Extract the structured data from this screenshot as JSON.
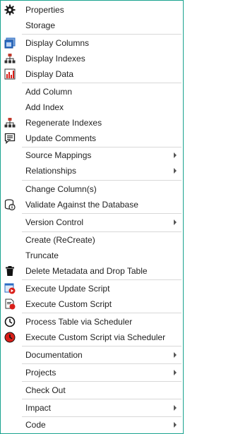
{
  "menu": {
    "items": {
      "properties": "Properties",
      "storage": "Storage",
      "display_columns": "Display Columns",
      "display_indexes": "Display Indexes",
      "display_data": "Display Data",
      "add_column": "Add Column",
      "add_index": "Add Index",
      "regenerate_indexes": "Regenerate Indexes",
      "update_comments": "Update Comments",
      "source_mappings": "Source Mappings",
      "relationships": "Relationships",
      "change_columns": "Change Column(s)",
      "validate_against_database": "Validate Against the Database",
      "version_control": "Version Control",
      "create_recreate": "Create (ReCreate)",
      "truncate": "Truncate",
      "delete_metadata_drop_table": "Delete Metadata and Drop Table",
      "execute_update_script": "Execute Update Script",
      "execute_custom_script": "Execute Custom Script",
      "process_table_via_scheduler": "Process Table via Scheduler",
      "execute_custom_script_via_scheduler": "Execute Custom Script via Scheduler",
      "documentation": "Documentation",
      "projects": "Projects",
      "check_out": "Check Out",
      "impact": "Impact",
      "code": "Code"
    }
  },
  "icons": {
    "properties": "gear-icon",
    "display_columns": "columns-window-icon",
    "display_indexes": "hierarchy-icon",
    "display_data": "bar-chart-icon",
    "regenerate_indexes": "hierarchy-icon",
    "update_comments": "comment-icon",
    "validate_against_database": "database-info-icon",
    "delete_metadata_drop_table": "trash-icon",
    "execute_update_script": "play-script-icon",
    "execute_custom_script": "custom-script-icon",
    "process_table_via_scheduler": "clock-icon",
    "execute_custom_script_via_scheduler": "clock-red-icon"
  },
  "colors": {
    "border": "#1aa38f",
    "separator": "#d8d8d8",
    "text": "#222222",
    "accent_blue": "#2b6cc4",
    "accent_red": "#d91e18",
    "submenu_arrow": "#555555"
  }
}
